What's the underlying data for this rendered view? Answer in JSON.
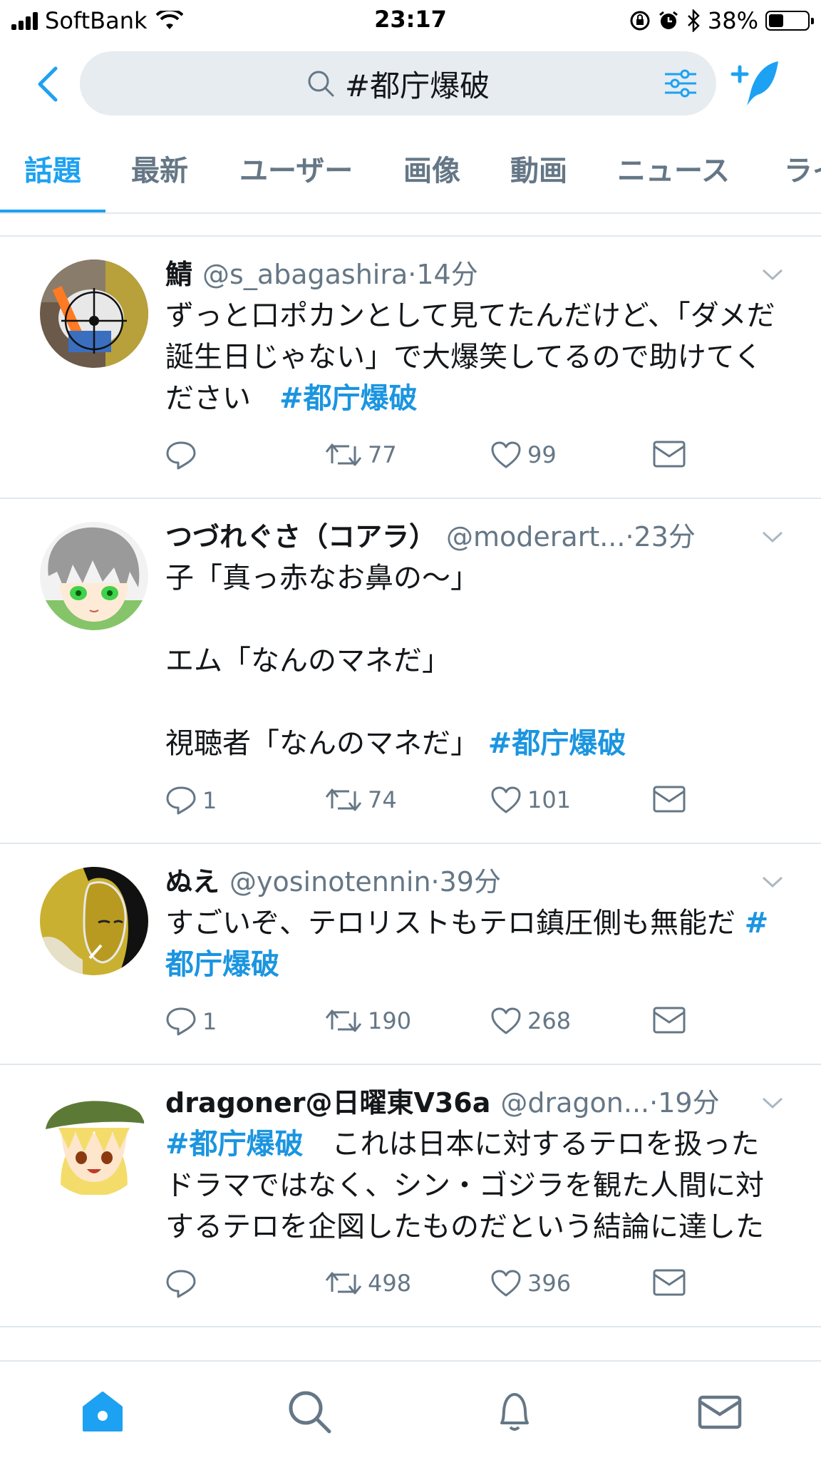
{
  "status_bar": {
    "carrier": "SoftBank",
    "time": "23:17",
    "battery": "38%",
    "battery_level": 0.38
  },
  "search": {
    "query": "#都庁爆破"
  },
  "tabs": [
    {
      "label": "話題",
      "active": true
    },
    {
      "label": "最新"
    },
    {
      "label": "ユーザー"
    },
    {
      "label": "画像"
    },
    {
      "label": "動画"
    },
    {
      "label": "ニュース"
    },
    {
      "label": "ライ"
    }
  ],
  "tweets": [
    {
      "name": "鯖",
      "handle": "@s_abagashira",
      "time": "14分",
      "text": "ずっと口ポカンとして見てたんだけど、「ダメだ誕生日じゃない」で大爆笑してるので助けてください　",
      "hashtag": "#都庁爆破",
      "replies": "",
      "retweets": "77",
      "likes": "99"
    },
    {
      "name": "つづれぐさ（コアラ）",
      "handle": "@moderart...",
      "time": "23分",
      "text": "子「真っ赤なお鼻の〜」\n\nエム「なんのマネだ」\n\n視聴者「なんのマネだ」 ",
      "hashtag": "#都庁爆破",
      "replies": "1",
      "retweets": "74",
      "likes": "101"
    },
    {
      "name": "ぬえ",
      "handle": "@yosinotennin",
      "time": "39分",
      "text": "すごいぞ、テロリストもテロ鎮圧側も無能だ ",
      "hashtag": "#都庁爆破",
      "replies": "1",
      "retweets": "190",
      "likes": "268"
    },
    {
      "name": "dragoner@日曜東V36a",
      "handle": "@dragon...",
      "time": "19分",
      "hashtag_first": "#都庁爆破",
      "text": "　これは日本に対するテロを扱ったドラマではなく、シン・ゴジラを観た人間に対するテロを企図したものだという結論に達した",
      "replies": "",
      "retweets": "498",
      "likes": "396"
    }
  ],
  "colors": {
    "accent": "#1da1f2",
    "hashtag": "#1b95e0",
    "muted": "#657786",
    "search_bg": "#e6ecf0"
  },
  "icons": {
    "back": "chevron-left-icon",
    "search": "search-icon",
    "filter": "filter-sliders-icon",
    "compose": "compose-tweet-icon",
    "reply": "reply-icon",
    "retweet": "retweet-icon",
    "like": "heart-icon",
    "dm": "envelope-icon",
    "home": "home-icon",
    "explore": "search-icon",
    "notifications": "bell-icon",
    "messages": "envelope-icon"
  }
}
